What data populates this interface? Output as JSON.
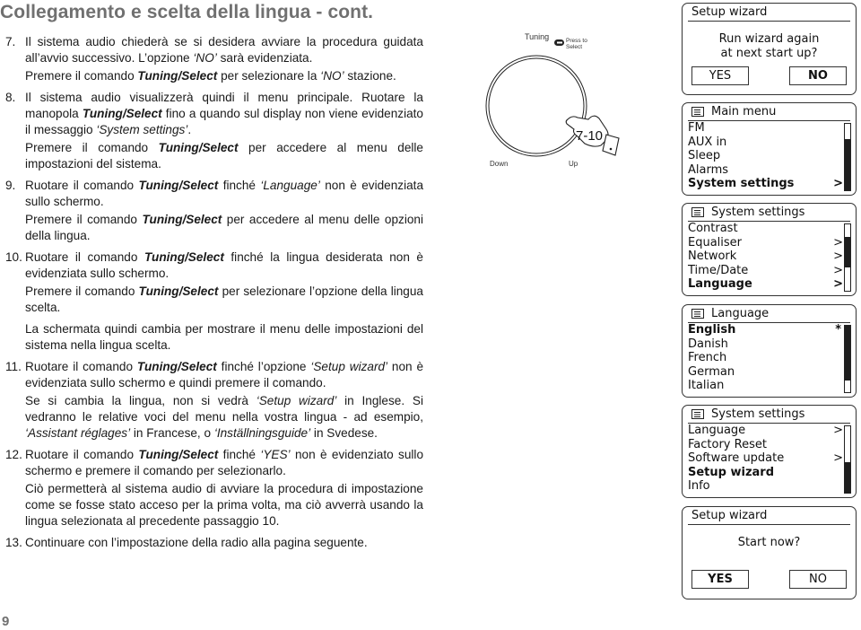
{
  "page": {
    "title": "Collegamento e scelta della lingua - cont.",
    "page_number": "9"
  },
  "steps": [
    {
      "num": "7.",
      "p1": [
        "Il sistema audio chiederà se si desidera avviare la procedura guidata all’avvio successivo. L’opzione ",
        "‘NO’",
        " sarà evidenziata."
      ],
      "p2": [
        "Premere il comando ",
        "Tuning/Select",
        " per selezionare la ",
        "‘NO’",
        " stazione."
      ]
    },
    {
      "num": "8.",
      "p1": [
        "Il sistema audio visualizzerà quindi il menu principale. Ruotare la manopola ",
        "Tuning/Select",
        " fino a quando sul display non viene evidenziato il messaggio ",
        "‘System settings’",
        "."
      ],
      "p2": [
        "Premere il comando ",
        "Tuning/Select",
        " per accedere al menu delle impostazioni del sistema."
      ]
    },
    {
      "num": "9.",
      "p1": [
        "Ruotare il comando ",
        "Tuning/Select",
        " finché ",
        "‘Language’",
        " non è evidenziata sullo schermo."
      ],
      "p2": [
        "Premere il comando ",
        "Tuning/Select",
        " per accedere al menu delle opzioni della lingua."
      ]
    },
    {
      "num": "10.",
      "p1": [
        "Ruotare il comando ",
        "Tuning/Select",
        " finché la lingua desiderata non è evidenziata sullo schermo."
      ],
      "p2": [
        "Premere il comando ",
        "Tuning/Select",
        " per selezionare l’opzione della lingua scelta."
      ],
      "p3": "La schermata quindi cambia per mostrare il menu delle impostazioni del sistema nella lingua scelta."
    },
    {
      "num": "11.",
      "p1": [
        "Ruotare il comando ",
        "Tuning/Select",
        " finché l’opzione ",
        "‘Setup wizard’",
        " non è evidenziata sullo schermo e quindi premere il comando."
      ],
      "p2": [
        "Se si cambia la lingua, non si vedrà ",
        "‘Setup wizard’",
        " in Inglese. Si vedranno le relative voci del menu nella vostra lingua - ad esempio, ",
        "‘Assistant réglages’",
        " in Francese, o ",
        "‘Inställningsguide’",
        " in Svedese."
      ]
    },
    {
      "num": "12.",
      "p1": [
        "Ruotare il comando ",
        "Tuning/Select",
        " finché ",
        "‘YES’",
        " non è evidenziato sullo schermo e premere il comando per selezionarlo."
      ],
      "p2": "Ciò permetterà al sistema audio di avviare la procedura di impostazione come se fosse stato acceso per la prima volta, ma ciò avverrà usando la lingua selezionata al precedente passaggio 10."
    },
    {
      "num": "13.",
      "p1": "Continuare con l’impostazione della radio alla pagina seguente."
    }
  ],
  "diagram": {
    "knob_label": "Tuning",
    "press_label_1": "Press to",
    "press_label_2": "Select",
    "down_label": "Down",
    "up_label": "Up",
    "step_ref": "7-10"
  },
  "screens": {
    "wizard_again": {
      "title": "Setup wizard",
      "line1": "Run wizard again",
      "line2": "at next start up?",
      "yes": "YES",
      "no": "NO",
      "selected": "NO"
    },
    "main_menu": {
      "title": "Main menu",
      "items": [
        {
          "label": "FM",
          "arrow": ""
        },
        {
          "label": "AUX in",
          "arrow": ""
        },
        {
          "label": "Sleep",
          "arrow": ""
        },
        {
          "label": "Alarms",
          "arrow": ""
        },
        {
          "label": "System settings",
          "arrow": ">"
        }
      ],
      "selected_index": 4
    },
    "system_settings_1": {
      "title": "System settings",
      "items": [
        {
          "label": "Contrast",
          "arrow": ""
        },
        {
          "label": "Equaliser",
          "arrow": ">"
        },
        {
          "label": "Network",
          "arrow": ">"
        },
        {
          "label": "Time/Date",
          "arrow": ">"
        },
        {
          "label": "Language",
          "arrow": ">"
        }
      ],
      "selected_index": 4
    },
    "language": {
      "title": "Language",
      "items": [
        {
          "label": "English",
          "mark": "*"
        },
        {
          "label": "Danish",
          "mark": ""
        },
        {
          "label": "French",
          "mark": ""
        },
        {
          "label": "German",
          "mark": ""
        },
        {
          "label": "Italian",
          "mark": ""
        }
      ],
      "selected_index": 0
    },
    "system_settings_2": {
      "title": "System settings",
      "items": [
        {
          "label": "Language",
          "arrow": ">"
        },
        {
          "label": "Factory Reset",
          "arrow": ""
        },
        {
          "label": "Software update",
          "arrow": ">"
        },
        {
          "label": "Setup wizard",
          "arrow": ""
        },
        {
          "label": "Info",
          "arrow": ""
        }
      ],
      "selected_index": 3
    },
    "start_now": {
      "title": "Setup wizard",
      "line1": "Start now?",
      "yes": "YES",
      "no": "NO",
      "selected": "YES"
    }
  }
}
